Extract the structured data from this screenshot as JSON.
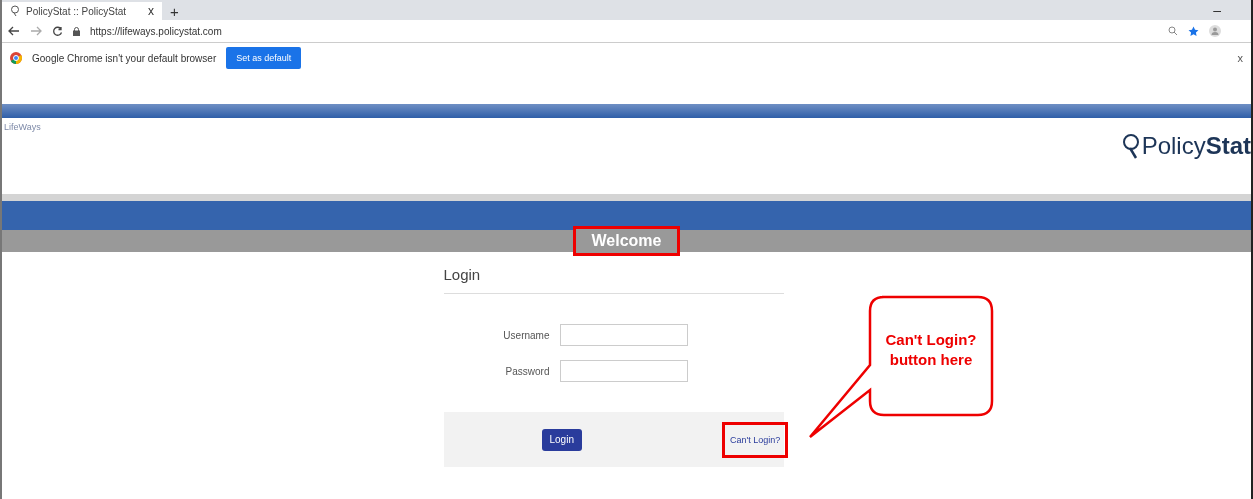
{
  "browser": {
    "tab": {
      "title": "PolicyStat :: PolicyStat",
      "close": "x",
      "new_tab": "+"
    },
    "address": "https://lifeways.policystat.com",
    "infobar": {
      "message": "Google Chrome isn't your default browser",
      "button": "Set as default",
      "close": "x"
    },
    "window_controls": {
      "minimize": "–"
    }
  },
  "header": {
    "org": "LifeWays",
    "logo_light": "Policy",
    "logo_bold": "Stat"
  },
  "welcome": {
    "text": "Welcome",
    "highlighted": true
  },
  "login": {
    "title": "Login",
    "fields": [
      {
        "label": "Username"
      },
      {
        "label": "Password"
      }
    ],
    "button": "Login",
    "link": {
      "text": "Can't Login?",
      "highlighted": true
    }
  },
  "callout": {
    "lines": [
      "Can't Login?",
      "button here"
    ]
  }
}
